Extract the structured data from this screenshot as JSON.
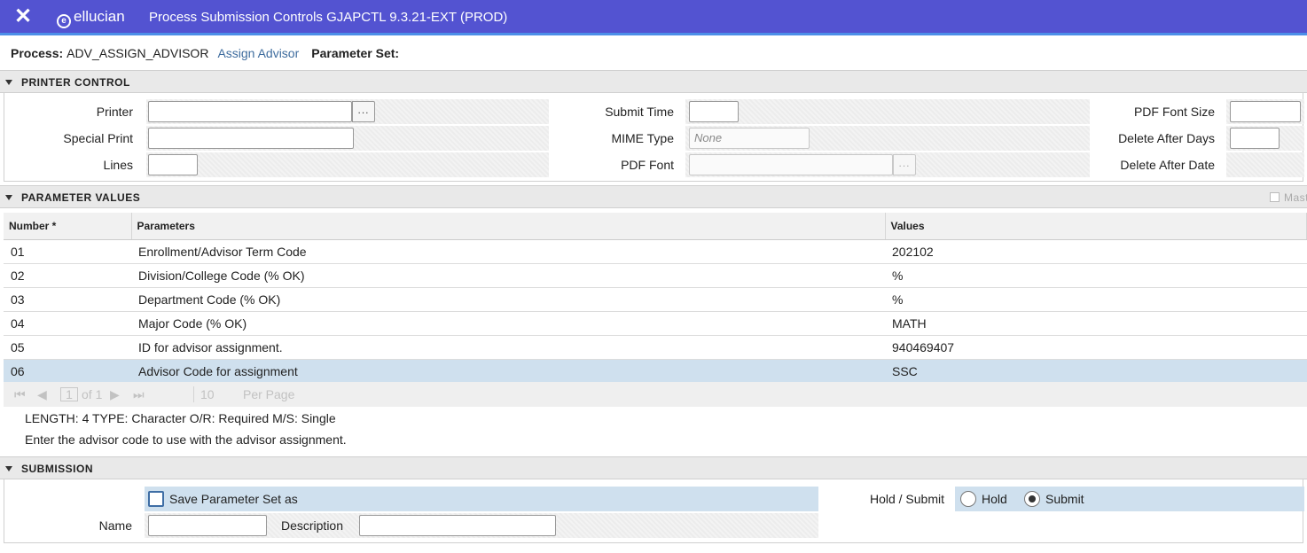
{
  "app": {
    "close_icon": "✕",
    "brand": "ellucian",
    "title": "Process Submission Controls GJAPCTL 9.3.21-EXT (PROD)"
  },
  "process": {
    "process_label": "Process:",
    "process_value": "ADV_ASSIGN_ADVISOR",
    "process_desc": "Assign Advisor",
    "param_set_label": "Parameter Set:"
  },
  "printer_control": {
    "header": "PRINTER CONTROL",
    "printer_label": "Printer",
    "special_print_label": "Special Print",
    "lines_label": "Lines",
    "submit_time_label": "Submit Time",
    "mime_type_label": "MIME Type",
    "mime_type_placeholder": "None",
    "pdf_font_label": "PDF Font",
    "pdf_font_size_label": "PDF Font Size",
    "delete_after_days_label": "Delete After Days",
    "delete_after_date_label": "Delete After Date",
    "lov_glyph": "..."
  },
  "parameter_values": {
    "header": "PARAMETER VALUES",
    "mast_label": "Mast",
    "columns": [
      "Number *",
      "Parameters",
      "Values"
    ],
    "rows": [
      {
        "number": "01",
        "parameter": "Enrollment/Advisor Term Code",
        "value": "202102"
      },
      {
        "number": "02",
        "parameter": "Division/College Code (% OK)",
        "value": "%"
      },
      {
        "number": "03",
        "parameter": "Department Code (% OK)",
        "value": "%"
      },
      {
        "number": "04",
        "parameter": "Major Code (% OK)",
        "value": "MATH"
      },
      {
        "number": "05",
        "parameter": "ID for advisor assignment.",
        "value": "940469407"
      },
      {
        "number": "06",
        "parameter": "Advisor Code for assignment",
        "value": "SSC"
      }
    ],
    "pager": {
      "page": "1",
      "of_label": "of 1",
      "per_page_value": "10",
      "per_page_label": "Per Page"
    },
    "help_line1": "LENGTH: 4 TYPE: Character O/R: Required M/S: Single",
    "help_line2": "Enter the advisor code to use with the advisor assignment."
  },
  "submission": {
    "header": "SUBMISSION",
    "save_param_label": "Save Parameter Set as",
    "name_label": "Name",
    "description_label": "Description",
    "hold_submit_label": "Hold / Submit",
    "hold_label": "Hold",
    "submit_label": "Submit",
    "selected": "Submit"
  }
}
